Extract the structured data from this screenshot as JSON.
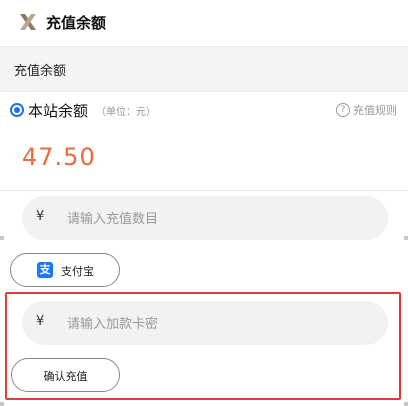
{
  "header": {
    "title": "充值余额",
    "logo_icon": "x-logo-icon"
  },
  "section": {
    "title": "充值余额"
  },
  "balance": {
    "label": "本站余额",
    "unit_hint": "（单位：元）",
    "rules_label": "充值规则",
    "rules_icon": "?",
    "amount": "47.50",
    "amount_color": "#ee6a3d",
    "selected": true
  },
  "recharge_amount_input": {
    "currency": "¥",
    "placeholder": "请输入充值数目"
  },
  "alipay_button": {
    "label": "支付宝",
    "icon_glyph": "支"
  },
  "card_input": {
    "currency": "¥",
    "placeholder": "请输入加款卡密"
  },
  "confirm_button": {
    "label": "确认充值"
  },
  "colors": {
    "accent": "#1a73e8",
    "highlight": "#e53935",
    "alipay": "#1677ff"
  }
}
